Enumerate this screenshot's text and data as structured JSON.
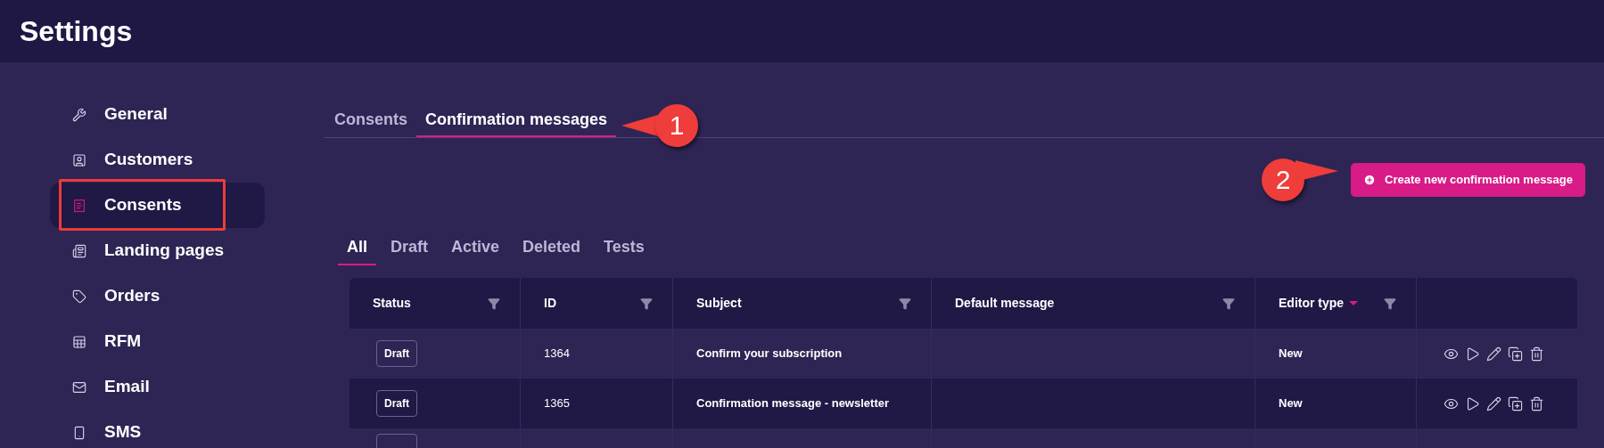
{
  "header": {
    "title": "Settings"
  },
  "sidebar": {
    "items": [
      {
        "label": "General",
        "selected": false,
        "outlined": false
      },
      {
        "label": "Customers",
        "selected": false,
        "outlined": false
      },
      {
        "label": "Consents",
        "selected": true,
        "outlined": true
      },
      {
        "label": "Landing pages",
        "selected": false,
        "outlined": false
      },
      {
        "label": "Orders",
        "selected": false,
        "outlined": false
      },
      {
        "label": "RFM",
        "selected": false,
        "outlined": false
      },
      {
        "label": "Email",
        "selected": false,
        "outlined": false
      },
      {
        "label": "SMS",
        "selected": false,
        "outlined": false
      }
    ]
  },
  "tabs": [
    {
      "label": "Consents",
      "selected": false
    },
    {
      "label": "Confirmation messages",
      "selected": true
    }
  ],
  "create_button": {
    "label": "Create new confirmation message"
  },
  "filter_tabs": [
    {
      "label": "All",
      "selected": true
    },
    {
      "label": "Draft",
      "selected": false
    },
    {
      "label": "Active",
      "selected": false
    },
    {
      "label": "Deleted",
      "selected": false
    },
    {
      "label": "Tests",
      "selected": false
    }
  ],
  "table": {
    "columns": [
      {
        "label": "Status",
        "filter": true,
        "sorted": false
      },
      {
        "label": "ID",
        "filter": true,
        "sorted": false
      },
      {
        "label": "Subject",
        "filter": true,
        "sorted": false
      },
      {
        "label": "Default message",
        "filter": true,
        "sorted": false
      },
      {
        "label": "Editor type",
        "filter": true,
        "sorted": true
      }
    ],
    "rows": [
      {
        "status": "Draft",
        "id": "1364",
        "subject": "Confirm your subscription",
        "editor_type": "New"
      },
      {
        "status": "Draft",
        "id": "1365",
        "subject": "Confirmation message - newsletter",
        "editor_type": "New"
      }
    ],
    "more_rows_below": true
  },
  "annotations": [
    {
      "label": "1"
    },
    {
      "label": "2"
    }
  ]
}
